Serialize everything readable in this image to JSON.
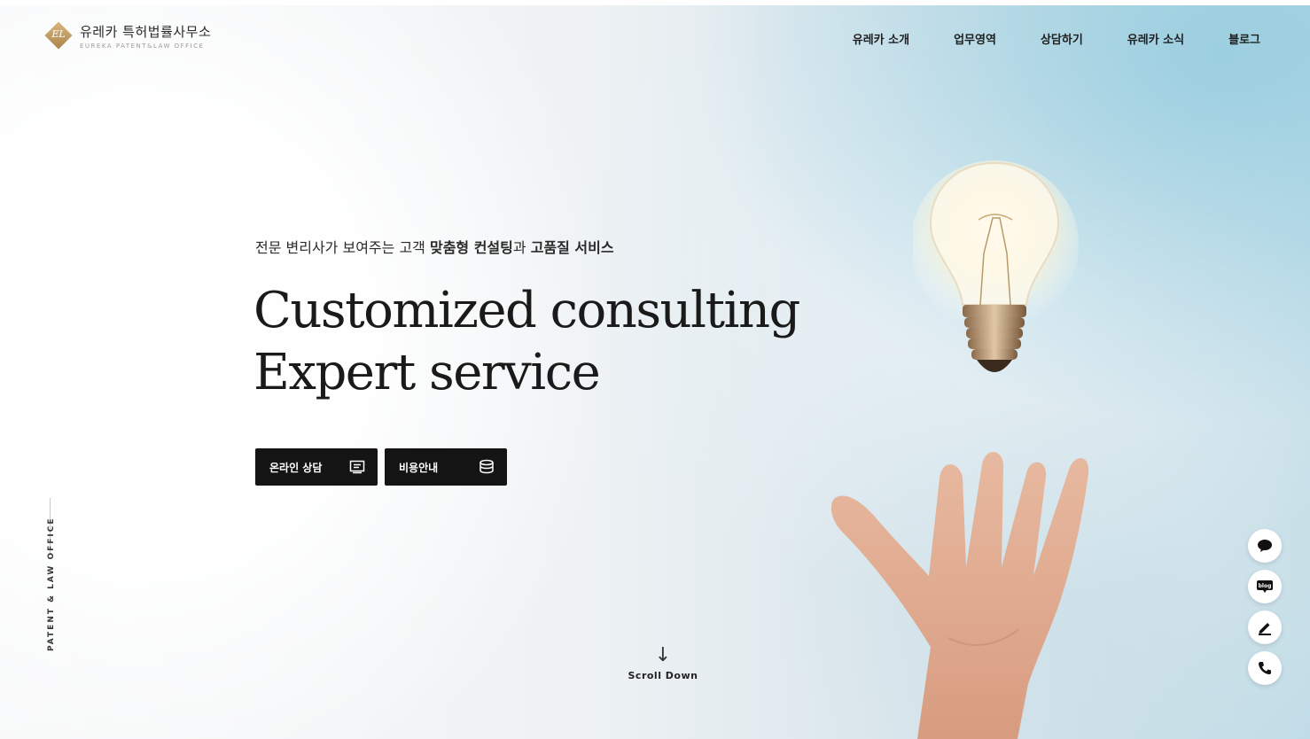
{
  "header": {
    "logo_ko": "유레카 특허법률사무소",
    "logo_en": "EUREKA PATENT&LAW OFFICE",
    "logo_mark": "EL",
    "nav": [
      {
        "label": "유레카 소개"
      },
      {
        "label": "업무영역"
      },
      {
        "label": "상담하기"
      },
      {
        "label": "유레카 소식"
      },
      {
        "label": "블로그"
      }
    ]
  },
  "hero": {
    "sub_plain1": "전문 변리사가 보여주는 고객 ",
    "sub_bold1": "맞춤형 컨설팅",
    "sub_plain2": "과 ",
    "sub_bold2": "고품질 서비스",
    "headline_line1": "Customized consulting",
    "headline_line2": "Expert service",
    "buttons": [
      {
        "label": "온라인 상담",
        "icon": "chat-box-icon"
      },
      {
        "label": "비용안내",
        "icon": "coins-icon"
      }
    ]
  },
  "side": {
    "vertical_text": "PATENT & LAW OFFICE"
  },
  "scroll": {
    "arrow": "↓",
    "label": "Scroll Down"
  },
  "floating": {
    "items": [
      {
        "icon": "speech-bubble-icon"
      },
      {
        "icon": "blog-icon",
        "text": "blog"
      },
      {
        "icon": "pencil-icon"
      },
      {
        "icon": "phone-icon"
      }
    ]
  }
}
